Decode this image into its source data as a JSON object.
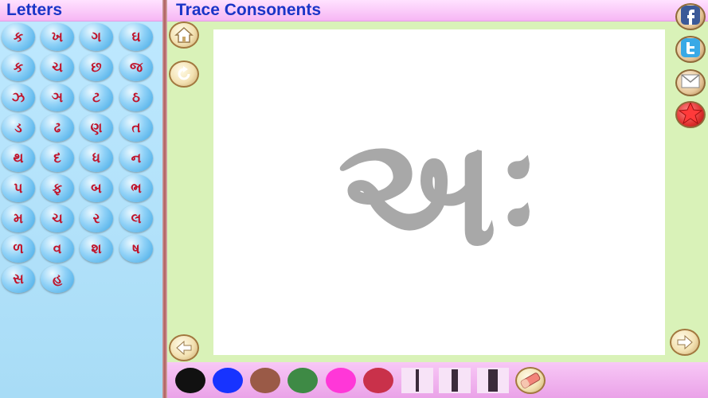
{
  "left_panel": {
    "title": "Letters",
    "letters": [
      "ક",
      "ખ",
      "ગ",
      "ઘ",
      "ક",
      "ચ",
      "છ",
      "જ",
      "ઝ",
      "ઞ",
      "ટ",
      "ઠ",
      "ડ",
      "ઢ",
      "ણ",
      "ત",
      "થ",
      "દ",
      "ધ",
      "ન",
      "પ",
      "ફ",
      "બ",
      "ભ",
      "મ",
      "ચ",
      "ર",
      "લ",
      "ળ",
      "વ",
      "શ",
      "ષ",
      "સ",
      "હ"
    ]
  },
  "main": {
    "title": "Trace Consonents",
    "trace_letter": "અઃ"
  },
  "toolbar": {
    "colors": [
      "#111111",
      "#1733ff",
      "#9a5a47",
      "#3e8a45",
      "#ff37d8",
      "#c9314a"
    ],
    "stroke_widths": [
      "thin",
      "medium",
      "thick"
    ],
    "eraser": "eraser-icon"
  },
  "social": [
    "facebook-icon",
    "twitter-icon",
    "mail-icon",
    "star-icon"
  ],
  "nav": [
    "home-icon",
    "refresh-icon",
    "back-arrow-icon",
    "next-arrow-icon"
  ]
}
